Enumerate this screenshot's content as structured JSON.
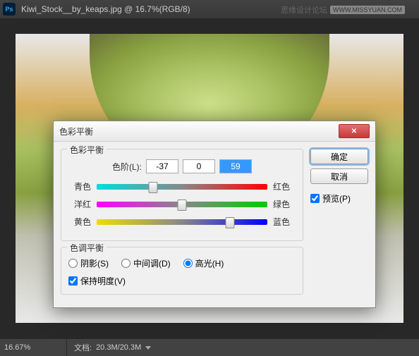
{
  "titlebar": {
    "title": "Kiwi_Stock__by_keaps.jpg @ 16.7%(RGB/8)",
    "watermark_text": "思缘设计论坛",
    "watermark_url": "WWW.MISSYUAN.COM"
  },
  "dialog": {
    "title": "色彩平衡",
    "close_glyph": "✕",
    "group_balance": "色彩平衡",
    "levels_label": "色阶(L):",
    "levels": [
      "-37",
      "0",
      "59"
    ],
    "sliders": [
      {
        "left": "青色",
        "right": "红色",
        "pos": 33
      },
      {
        "left": "洋红",
        "right": "绿色",
        "pos": 50
      },
      {
        "left": "黄色",
        "right": "蓝色",
        "pos": 78
      }
    ],
    "group_tone": "色调平衡",
    "tone_options": [
      {
        "label": "阴影(S)",
        "checked": false
      },
      {
        "label": "中间调(D)",
        "checked": false
      },
      {
        "label": "高光(H)",
        "checked": true
      }
    ],
    "preserve_luminosity": "保持明度(V)",
    "ok": "确定",
    "cancel": "取消",
    "preview": "预览(P)"
  },
  "statusbar": {
    "zoom": "16.67%",
    "doc_label": "文档:",
    "doc_size": "20.3M/20.3M"
  }
}
